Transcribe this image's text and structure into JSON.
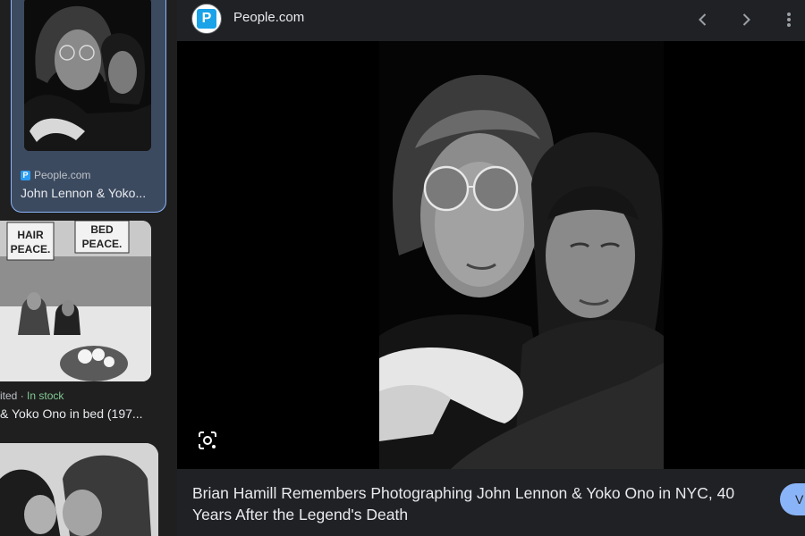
{
  "results": [
    {
      "source": "People.com",
      "favicon_letter": "P",
      "title": "John Lennon & Yoko..."
    },
    {
      "sign_left": "HAIR PEACE.",
      "sign_right": "BED PEACE.",
      "meta_source": "ited",
      "meta_sep": " · ",
      "meta_stock": "In stock",
      "title": "& Yoko Ono in bed (197..."
    },
    {}
  ],
  "preview": {
    "site_name": "People.com",
    "logo_letter": "P",
    "headline": "Brian Hamill Remembers Photographing John Lennon & Yoko Ono in NYC, 40 Years After the Legend's Death",
    "visit_label": "V"
  },
  "icons": [
    "chevron-left-icon",
    "chevron-right-icon",
    "more-vert-icon",
    "google-lens-icon"
  ],
  "colors": {
    "accent": "#8ab4f8",
    "in_stock": "#81c995",
    "background": "#202124",
    "selected_card": "#3c4a60"
  }
}
